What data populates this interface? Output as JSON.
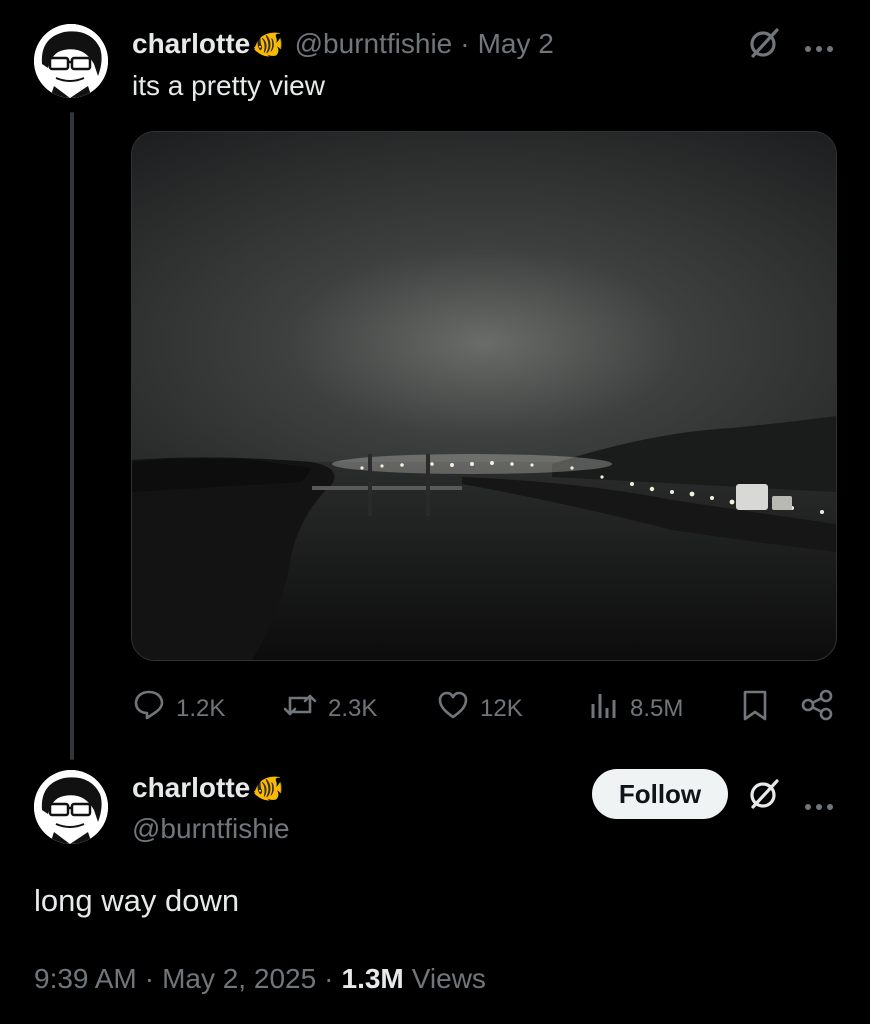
{
  "tweet": {
    "display_name": "charlotte",
    "emoji": "🐠",
    "handle": "@burntfishie",
    "separator": "·",
    "date": "May 2",
    "text": "its a pretty view",
    "stats": {
      "replies": "1.2K",
      "reposts": "2.3K",
      "likes": "12K",
      "views": "8.5M"
    },
    "icons": [
      "grok-icon",
      "more-icon",
      "reply-icon",
      "repost-icon",
      "like-icon",
      "views-icon",
      "bookmark-icon",
      "share-icon"
    ]
  },
  "reply": {
    "display_name": "charlotte",
    "emoji": "🐠",
    "handle": "@burntfishie",
    "follow_label": "Follow",
    "text": "long way down",
    "time": "9:39 AM",
    "date": "May 2, 2025",
    "views_count": "1.3M",
    "views_label": "Views",
    "separator": "·"
  },
  "colors": {
    "background": "#000000",
    "text": "#e7e9ea",
    "muted": "#71767b",
    "follow_bg": "#eff3f4"
  }
}
